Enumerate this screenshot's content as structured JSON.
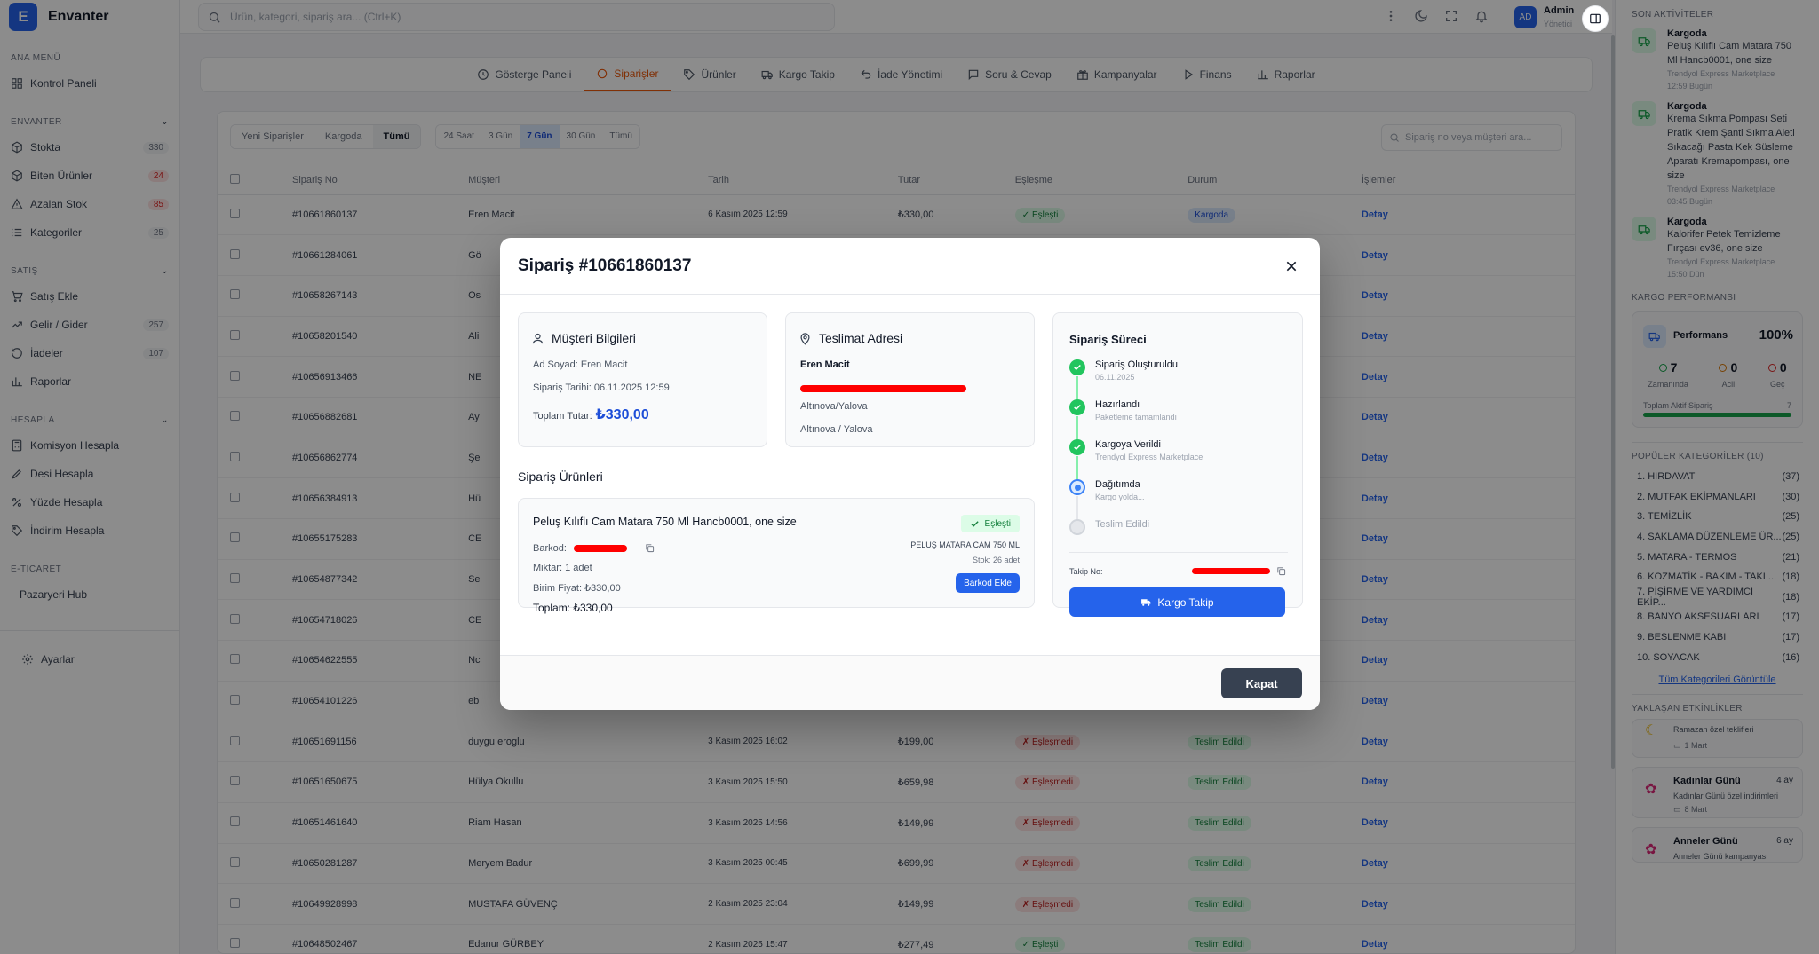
{
  "brand": {
    "logo_letter": "E",
    "name": "Envanter",
    "accent": "#2563eb"
  },
  "sidebar": {
    "sections": [
      {
        "title": "ANA MENÜ",
        "items": [
          {
            "label": "Kontrol Paneli",
            "icon": "grid-icon",
            "badge": ""
          }
        ]
      },
      {
        "title": "ENVANTER",
        "items": [
          {
            "label": "Stokta",
            "icon": "box-icon",
            "badge": "330"
          },
          {
            "label": "Biten Ürünler",
            "icon": "box-icon",
            "badge": "24",
            "badge_red": true
          },
          {
            "label": "Azalan Stok",
            "icon": "warning-icon",
            "badge": "85",
            "badge_red": true
          },
          {
            "label": "Kategoriler",
            "icon": "list-icon",
            "badge": "25"
          }
        ]
      },
      {
        "title": "SATIŞ",
        "items": [
          {
            "label": "Satış Ekle",
            "icon": "cart-icon",
            "badge": ""
          },
          {
            "label": "Gelir / Gider",
            "icon": "trend-icon",
            "badge": "257"
          },
          {
            "label": "İadeler",
            "icon": "return-icon",
            "badge": "107"
          },
          {
            "label": "Raporlar",
            "icon": "bar-chart-icon",
            "badge": ""
          }
        ]
      },
      {
        "title": "HESAPLA",
        "items": [
          {
            "label": "Komisyon Hesapla",
            "icon": "calculator-icon",
            "badge": ""
          },
          {
            "label": "Desi Hesapla",
            "icon": "pencil-icon",
            "badge": ""
          },
          {
            "label": "Yüzde Hesapla",
            "icon": "percent-icon",
            "badge": ""
          },
          {
            "label": "İndirim Hesapla",
            "icon": "tag-icon",
            "badge": ""
          }
        ]
      },
      {
        "title": "E-TİCARET",
        "items": [
          {
            "label": "Pazaryeri Hub",
            "icon": "",
            "badge": ""
          }
        ]
      }
    ],
    "settings_label": "Ayarlar"
  },
  "topbar": {
    "search_placeholder": "Ürün, kategori, sipariş ara... (Ctrl+K)",
    "avatar_initials": "AD",
    "user_name": "Admin",
    "user_role": "Yönetici"
  },
  "tabs": [
    {
      "label": "Gösterge Paneli",
      "icon": "clock-icon"
    },
    {
      "label": "Siparişler",
      "icon": "circle-icon",
      "active": true
    },
    {
      "label": "Ürünler",
      "icon": "tag-icon"
    },
    {
      "label": "Kargo Takip",
      "icon": "truck-icon"
    },
    {
      "label": "İade Yönetimi",
      "icon": "undo-icon"
    },
    {
      "label": "Soru & Cevap",
      "icon": "chat-icon"
    },
    {
      "label": "Kampanyalar",
      "icon": "gift-icon"
    },
    {
      "label": "Finans",
      "icon": "play-icon"
    },
    {
      "label": "Raporlar",
      "icon": "bar-chart-icon"
    }
  ],
  "filters": {
    "status": [
      {
        "label": "Yeni Siparişler"
      },
      {
        "label": "Kargoda"
      },
      {
        "label": "Tümü",
        "on": true
      }
    ],
    "range": [
      {
        "label": "24 Saat"
      },
      {
        "label": "3 Gün"
      },
      {
        "label": "7 Gün",
        "on": true
      },
      {
        "label": "30 Gün"
      },
      {
        "label": "Tümü"
      }
    ],
    "search_placeholder": "Sipariş no veya müşteri ara..."
  },
  "table": {
    "headers": [
      "Sipariş No",
      "Müşteri",
      "Tarih",
      "Tutar",
      "Eşleşme",
      "Durum",
      "İşlemler"
    ],
    "rows": [
      {
        "no": "#10661860137",
        "customer": "Eren Macit",
        "date": "6 Kasım 2025 12:59",
        "amount": "₺330,00",
        "match": "✓ Eşleşti",
        "match_ok": true,
        "status": "Kargoda",
        "status_type": "cargo",
        "action": "Detay"
      },
      {
        "no": "#10661284061",
        "customer": "Gö",
        "date": "",
        "amount": "",
        "match": "",
        "status": "",
        "action": "Detay"
      },
      {
        "no": "#10658267143",
        "customer": "Os",
        "date": "",
        "amount": "",
        "match": "",
        "status": "",
        "action": "Detay"
      },
      {
        "no": "#10658201540",
        "customer": "Ali",
        "date": "",
        "amount": "",
        "match": "",
        "status": "",
        "action": "Detay"
      },
      {
        "no": "#10656913466",
        "customer": "NE",
        "date": "",
        "amount": "",
        "match": "",
        "status": "",
        "action": "Detay"
      },
      {
        "no": "#10656882681",
        "customer": "Ay",
        "date": "",
        "amount": "",
        "match": "",
        "status": "",
        "action": "Detay"
      },
      {
        "no": "#10656862774",
        "customer": "Şe",
        "date": "",
        "amount": "",
        "match": "",
        "status": "",
        "action": "Detay"
      },
      {
        "no": "#10656384913",
        "customer": "Hü",
        "date": "",
        "amount": "",
        "match": "",
        "status": "",
        "action": "Detay"
      },
      {
        "no": "#10655175283",
        "customer": "CE",
        "date": "",
        "amount": "",
        "match": "",
        "status": "",
        "action": "Detay"
      },
      {
        "no": "#10654877342",
        "customer": "Se",
        "date": "",
        "amount": "",
        "match": "",
        "status": "",
        "action": "Detay"
      },
      {
        "no": "#10654718026",
        "customer": "CE",
        "date": "",
        "amount": "",
        "match": "",
        "status": "",
        "action": "Detay"
      },
      {
        "no": "#10654622555",
        "customer": "Nc",
        "date": "",
        "amount": "",
        "match": "",
        "status": "",
        "action": "Detay"
      },
      {
        "no": "#10654101226",
        "customer": "eb",
        "date": "",
        "amount": "",
        "match": "",
        "status": "",
        "action": "Detay"
      },
      {
        "no": "#10651691156",
        "customer": "duygu eroglu",
        "date": "3 Kasım 2025 16:02",
        "amount": "₺199,00",
        "match": "✗ Eşleşmedi",
        "match_ok": false,
        "status": "Teslim Edildi",
        "status_type": "done",
        "action": "Detay"
      },
      {
        "no": "#10651650675",
        "customer": "Hülya Okullu",
        "date": "3 Kasım 2025 15:50",
        "amount": "₺659,98",
        "match": "✗ Eşleşmedi",
        "match_ok": false,
        "status": "Teslim Edildi",
        "status_type": "done",
        "action": "Detay"
      },
      {
        "no": "#10651461640",
        "customer": "Riam Hasan",
        "date": "3 Kasım 2025 14:56",
        "amount": "₺149,99",
        "match": "✗ Eşleşmedi",
        "match_ok": false,
        "status": "Teslim Edildi",
        "status_type": "done",
        "action": "Detay"
      },
      {
        "no": "#10650281287",
        "customer": "Meryem Badur",
        "date": "3 Kasım 2025 00:45",
        "amount": "₺699,99",
        "match": "✗ Eşleşmedi",
        "match_ok": false,
        "status": "Teslim Edildi",
        "status_type": "done",
        "action": "Detay"
      },
      {
        "no": "#10649928998",
        "customer": "MUSTAFA GÜVENÇ",
        "date": "2 Kasım 2025 23:04",
        "amount": "₺149,99",
        "match": "✗ Eşleşmedi",
        "match_ok": false,
        "status": "Teslim Edildi",
        "status_type": "done",
        "action": "Detay"
      },
      {
        "no": "#10648502467",
        "customer": "Edanur GÜRBEY",
        "date": "2 Kasım 2025 15:47",
        "amount": "₺277,49",
        "match": "✓ Eşleşti",
        "match_ok": true,
        "status": "Teslim Edildi",
        "status_type": "done",
        "action": "Detay"
      }
    ]
  },
  "right_panel": {
    "activities_title": "SON AKTİVİTELER",
    "activities": [
      {
        "title": "Kargoda",
        "text": "Peluş Kılıflı Cam Matara 750 Ml Hancb0001, one size",
        "meta1": "Trendyol Express Marketplace",
        "meta2": "12:59 Bugün"
      },
      {
        "title": "Kargoda",
        "text": "Krema Sıkma Pompası Seti Pratik Krem Şanti Sıkma Aleti Sıkacağı Pasta Kek Süsleme Aparatı Kremapompası, one size",
        "meta1": "Trendyol Express Marketplace",
        "meta2": "03:45 Bugün"
      },
      {
        "title": "Kargoda",
        "text": "Kalorifer Petek Temizleme Fırçası ev36, one size",
        "meta1": "Trendyol Express Marketplace",
        "meta2": "15:50 Dün"
      }
    ],
    "perf_title": "KARGO PERFORMANSI",
    "perf_label": "Performans",
    "perf_value": "100%",
    "stats": [
      {
        "value": "7",
        "label": "Zamanında",
        "color": "#16a34a"
      },
      {
        "value": "0",
        "label": "Acil",
        "color": "#d97706"
      },
      {
        "value": "0",
        "label": "Geç",
        "color": "#dc2626"
      }
    ],
    "active_label": "Toplam Aktif Sipariş",
    "active_value": "7",
    "active_progress": 1.0,
    "categories_title": "POPÜLER KATEGORİLER (10)",
    "categories": [
      {
        "name": "1. HIRDAVAT",
        "count": "(37)"
      },
      {
        "name": "2. MUTFAK EKİPMANLARI",
        "count": "(30)"
      },
      {
        "name": "3. TEMİZLİK",
        "count": "(25)"
      },
      {
        "name": "4. SAKLAMA DÜZENLEME ÜR...",
        "count": "(25)"
      },
      {
        "name": "5. MATARA - TERMOS",
        "count": "(21)"
      },
      {
        "name": "6. KOZMATİK - BAKIM - TAKI ...",
        "count": "(18)"
      },
      {
        "name": "7. PİŞİRME VE YARDIMCI EKİP...",
        "count": "(18)"
      },
      {
        "name": "8. BANYO AKSESUARLARI",
        "count": "(17)"
      },
      {
        "name": "9. BESLENME KABI",
        "count": "(17)"
      },
      {
        "name": "10. SOYACAK",
        "count": "(16)"
      }
    ],
    "all_categories_link": "Tüm Kategorileri Görüntüle",
    "events_title": "YAKLAŞAN ETKİNLİKLER",
    "events": [
      {
        "title": "",
        "text": "Ramazan özel teklifleri",
        "date": "1 Mart",
        "badge": ""
      },
      {
        "title": "Kadınlar Günü",
        "text": "Kadınlar Günü özel indirimleri",
        "date": "8 Mart",
        "badge": "4 ay"
      },
      {
        "title": "Anneler Günü",
        "text": "Anneler Günü kampanyası",
        "date": "",
        "badge": "6 ay"
      }
    ]
  },
  "modal": {
    "title": "Sipariş #10661860137",
    "customer_box": {
      "title": "Müşteri Bilgileri",
      "name_label": "Ad Soyad:",
      "name": "Eren Macit",
      "date_label": "Sipariş Tarihi:",
      "date": "06.11.2025 12:59",
      "total_label": "Toplam Tutar:",
      "total": "₺330,00"
    },
    "address_box": {
      "title": "Teslimat Adresi",
      "name": "Eren Macit",
      "line1": "Altınova/Yalova",
      "line2": "Altınova / Yalova"
    },
    "products_title": "Sipariş Ürünleri",
    "product": {
      "name": "Peluş Kılıflı Cam Matara 750 Ml Hancb0001, one size",
      "match": "Eşleşti",
      "barcode_label": "Barkod:",
      "qty_label": "Miktar:",
      "qty": "1 adet",
      "unit_label": "Birim Fiyat:",
      "unit": "₺330,00",
      "total_label": "Toplam:",
      "total": "₺330,00",
      "matched_name": "PELUŞ MATARA CAM 750 ML",
      "stock": "Stok: 26 adet",
      "barcode_button": "Barkod Ekle"
    },
    "process": {
      "title": "Sipariş Süreci",
      "steps": [
        {
          "name": "Sipariş Oluşturuldu",
          "sub": "06.11.2025",
          "state": "done"
        },
        {
          "name": "Hazırlandı",
          "sub": "Paketleme tamamlandı",
          "state": "done"
        },
        {
          "name": "Kargoya Verildi",
          "sub": "Trendyol Express Marketplace",
          "state": "done"
        },
        {
          "name": "Dağıtımda",
          "sub": "Kargo yolda...",
          "state": "current"
        },
        {
          "name": "Teslim Edildi",
          "sub": "",
          "state": "todo"
        }
      ],
      "tracking_label": "Takip No:",
      "track_button": "Kargo Takip"
    },
    "close_button": "Kapat"
  }
}
